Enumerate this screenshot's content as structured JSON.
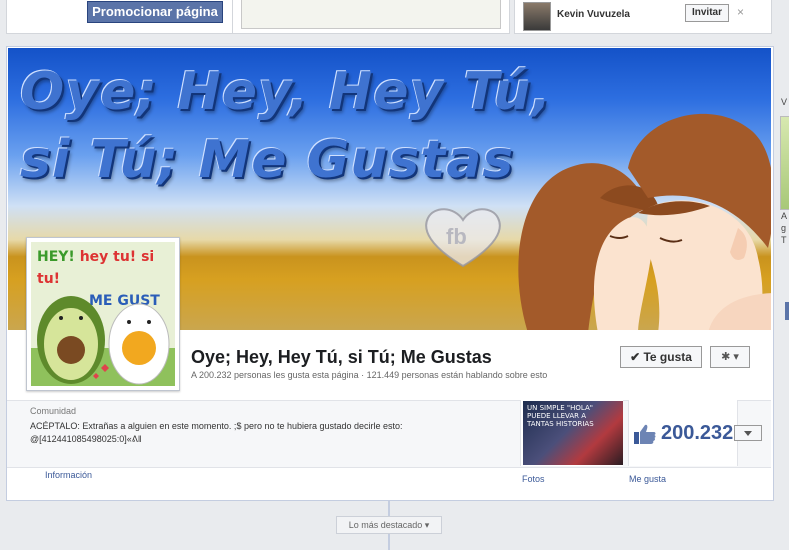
{
  "top": {
    "promote_label": "Promocionar página",
    "friend_name": "Kevin Vuvuzela",
    "invite_label": "Invitar",
    "close_glyph": "×"
  },
  "cover": {
    "title_line1": "Oye; Hey, Hey Tú,",
    "title_line2": "si Tú; Me Gustas",
    "watermark": "fb"
  },
  "profile_picture": {
    "line1_a": "HEY! ",
    "line1_b": "hey tu! ",
    "line1_c": "si tu!",
    "line2": "ME GUST"
  },
  "page": {
    "name": "Oye; Hey, Hey Tú, si Tú; Me Gustas",
    "stats": "A 200.232 personas les gusta esta página · 121.449 personas están hablando sobre esto",
    "like_button": "Te gusta",
    "like_check": "✔",
    "gear_glyph": "✱ ▾",
    "category": "Comunidad",
    "description": "ACÉPTALO: Extrañas a alguien en este momento. ;$ pero no te hubiera gustado decirle esto: @[412441085498025:0]«ᕕ‖",
    "info_link": "Información",
    "photos_label": "Fotos",
    "photos_text": "UN SIMPLE \"HOLA\" PUEDE LLEVAR A TANTAS HISTORIAS",
    "likes_count": "200.232",
    "likes_label": "Me gusta"
  },
  "timeline": {
    "highlights_label": "Lo más destacado ▾"
  },
  "sidebar": {
    "letter_top": "V",
    "text_lines": "A\ng\nT"
  },
  "colors": {
    "facebook_blue": "#3b5998",
    "button_blue": "#5b74a8",
    "cover_sky": "#2d6ee0",
    "cover_sand": "#d7a020"
  }
}
